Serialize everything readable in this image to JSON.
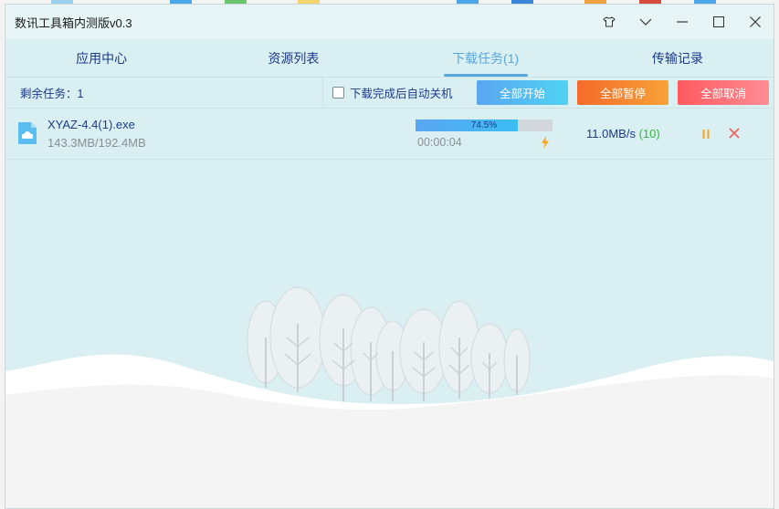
{
  "window": {
    "title": "数讯工具箱内测版v0.3"
  },
  "tabs": [
    {
      "label": "应用中心"
    },
    {
      "label": "资源列表"
    },
    {
      "label": "下载任务(1)"
    },
    {
      "label": "传输记录"
    }
  ],
  "toolbar": {
    "remaining": "剩余任务：1",
    "auto_shutdown_label": "下载完成后自动关机",
    "start_all": "全部开始",
    "pause_all": "全部暂停",
    "cancel_all": "全部取消"
  },
  "task": {
    "file_name": "XYAZ-4.4(1).exe",
    "size_progress": "143.3MB/192.4MB",
    "progress_percent": 74.5,
    "progress_label": "74.5%",
    "elapsed": "00:00:04",
    "speed": "11.0MB/s",
    "threads": "(10)"
  },
  "colors": {
    "accent": "#58a8de",
    "text_primary": "#1a3a8a",
    "start_btn": "#5aa6f2",
    "pause_btn": "#f66a2a",
    "cancel_btn": "#ff5a5f",
    "threads_green": "#35b93c"
  },
  "icons": {
    "shirt": "tshirt-icon",
    "minimize": "chevron-down-icon",
    "min": "minimize-icon",
    "max": "maximize-icon",
    "close": "close-icon",
    "file": "file-icon",
    "bolt": "lightning-icon",
    "pause": "pause-icon",
    "cancel": "cancel-icon"
  }
}
